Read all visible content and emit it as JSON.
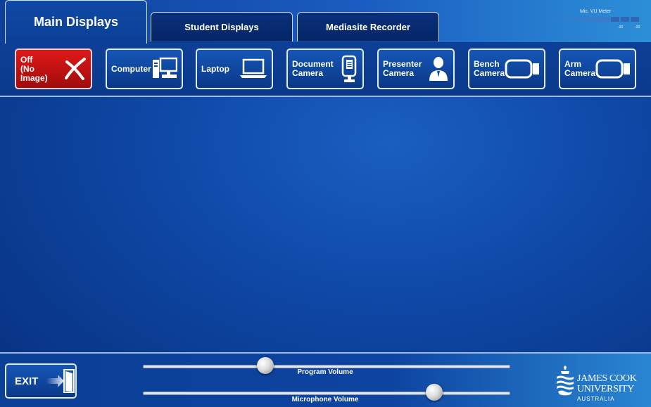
{
  "tabs": [
    {
      "label": "Main Displays",
      "active": true
    },
    {
      "label": "Student Displays",
      "active": false
    },
    {
      "label": "Mediasite Recorder",
      "active": false
    }
  ],
  "vu_meter": {
    "label": "Mic. VU Meter",
    "tick_left": "-20",
    "tick_right": "-20"
  },
  "sources": [
    {
      "label": "Off\n(No Image)",
      "icon": "x-icon",
      "state": "off"
    },
    {
      "label": "Computer",
      "icon": "desktop-computer-icon"
    },
    {
      "label": "Laptop",
      "icon": "laptop-icon"
    },
    {
      "label": "Document\nCamera",
      "icon": "document-camera-icon"
    },
    {
      "label": "Presenter\nCamera",
      "icon": "presenter-icon"
    },
    {
      "label": "Bench\nCamera",
      "icon": "camera-icon"
    },
    {
      "label": "Arm\nCamera",
      "icon": "camera-icon"
    }
  ],
  "bottom": {
    "exit_label": "EXIT",
    "program_volume": {
      "label": "Program Volume",
      "level": 0.33
    },
    "microphone_volume": {
      "label": "Microphone Volume",
      "level": 0.79
    }
  },
  "logo": {
    "line1": "JAMES COOK",
    "line2": "UNIVERSITY",
    "line3": "AUSTRALIA"
  },
  "colors": {
    "accent_blue": "#0c3f96",
    "off_red": "#d01414",
    "tab_dark": "#062666"
  }
}
